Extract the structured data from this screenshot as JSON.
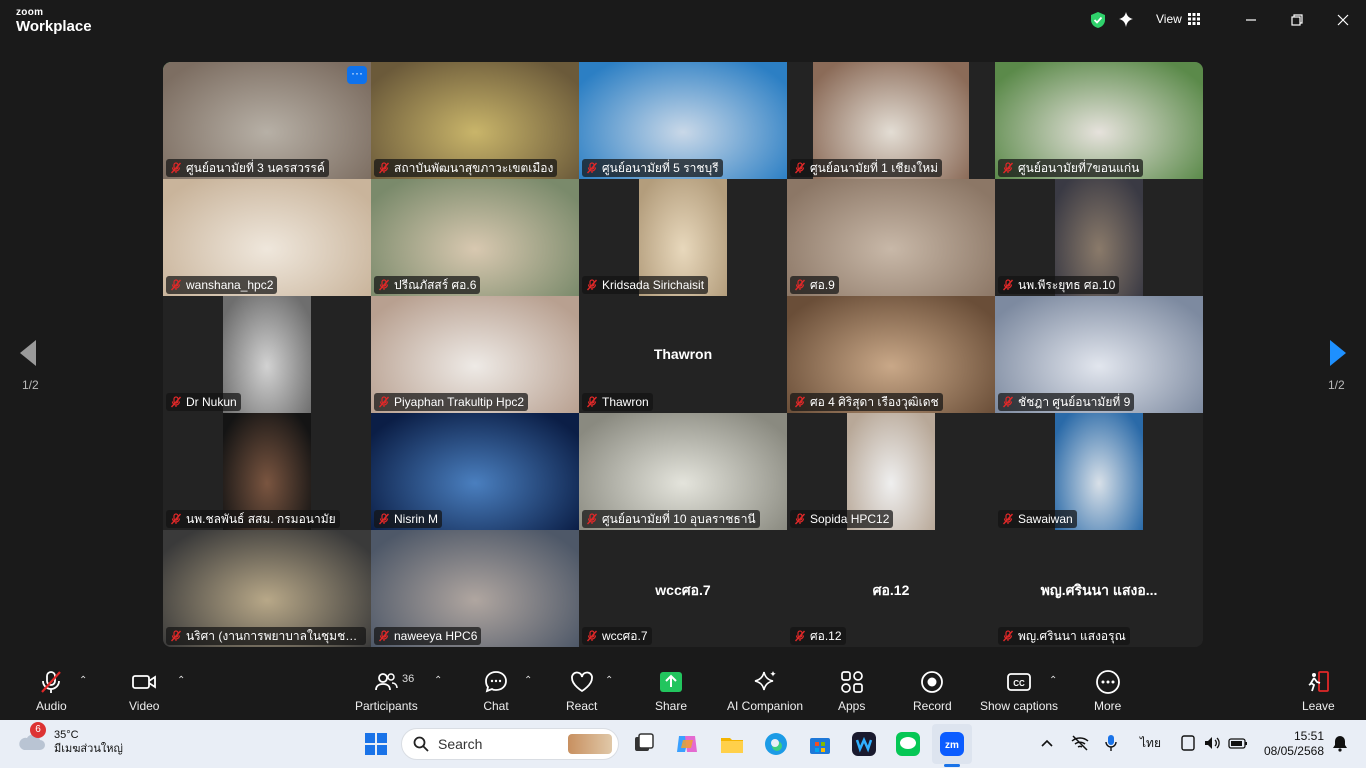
{
  "app": {
    "brand_top": "zoom",
    "brand_bottom": "Workplace",
    "view_label": "View"
  },
  "colors": {
    "active_speaker": "#2fd16b",
    "muted_icon": "#e02828",
    "share_green": "#22c55e",
    "leave_red": "#e02828"
  },
  "pager": {
    "left": "1/2",
    "right": "1/2"
  },
  "tiles": [
    {
      "name": "ศูนย์อนามัยที่ 3 นครสวรรค์",
      "video": true,
      "active": true,
      "more": "···",
      "v": {
        "l": 0,
        "w": 208,
        "c1": "#7d6e62",
        "c2": "#b7b0a6"
      }
    },
    {
      "name": "สถาบันพัฒนาสุขภาวะเขตเมือง",
      "video": true,
      "v": {
        "l": 0,
        "w": 208,
        "c1": "#6b5a3a",
        "c2": "#c9b56a"
      }
    },
    {
      "name": "ศูนย์อนามัยที่ 5 ราชบุรี",
      "video": true,
      "v": {
        "l": 0,
        "w": 208,
        "c1": "#2c7fc4",
        "c2": "#c9d8e8"
      }
    },
    {
      "name": "ศูนย์อนามัยที่ 1 เชียงใหม่",
      "video": true,
      "v": {
        "l": 26,
        "w": 156,
        "c1": "#8b6b58",
        "c2": "#e3ddd4"
      }
    },
    {
      "name": "ศูนย์อนามัยที่7ขอนแก่น",
      "video": true,
      "v": {
        "l": 0,
        "w": 208,
        "c1": "#5b8a4a",
        "c2": "#e6e2dc"
      }
    },
    {
      "name": "wanshana_hpc2",
      "video": true,
      "v": {
        "l": 0,
        "w": 208,
        "c1": "#c9b49b",
        "c2": "#efe7dc"
      }
    },
    {
      "name": "ปรีณภัสสร์ ศอ.6",
      "video": true,
      "v": {
        "l": 0,
        "w": 208,
        "c1": "#7a8a6b",
        "c2": "#d8c8b0"
      }
    },
    {
      "name": "Kridsada Sirichaisit",
      "video": true,
      "v": {
        "l": 60,
        "w": 88,
        "c1": "#b39d7c",
        "c2": "#e8d8bc"
      }
    },
    {
      "name": "ศอ.9",
      "video": true,
      "v": {
        "l": 0,
        "w": 208,
        "c1": "#8c7766",
        "c2": "#c8b8a8"
      }
    },
    {
      "name": "นพ.พีระยุทธ ศอ.10",
      "video": true,
      "v": {
        "l": 60,
        "w": 88,
        "c1": "#3a3a44",
        "c2": "#8a7a6a"
      }
    },
    {
      "name": "Dr Nukun",
      "video": true,
      "v": {
        "l": 60,
        "w": 88,
        "c1": "#6e6e6e",
        "c2": "#d2d2d2"
      }
    },
    {
      "name": "Piyaphan Trakultip Hpc2",
      "video": true,
      "v": {
        "l": 0,
        "w": 208,
        "c1": "#b8a090",
        "c2": "#eeeae6"
      }
    },
    {
      "name": "Thawron",
      "video": false,
      "center": "Thawron"
    },
    {
      "name": "ศอ 4 ศิริสุดา เรืองวุฒิเดช",
      "video": true,
      "v": {
        "l": 0,
        "w": 208,
        "c1": "#6a4e38",
        "c2": "#c9a888"
      }
    },
    {
      "name": "ชัชฎา ศูนย์อนามัยที่ 9",
      "video": true,
      "v": {
        "l": 0,
        "w": 208,
        "c1": "#7d8aa0",
        "c2": "#e2e6ee"
      }
    },
    {
      "name": "นพ.ชลพันธ์ สสม. กรมอนามัย",
      "video": true,
      "v": {
        "l": 60,
        "w": 88,
        "c1": "#141414",
        "c2": "#7a5540"
      }
    },
    {
      "name": "Nisrin M",
      "video": true,
      "v": {
        "l": 0,
        "w": 208,
        "c1": "#0b1e46",
        "c2": "#4a7fbf"
      }
    },
    {
      "name": "ศูนย์อนามัยที่ 10 อุบลราชธานี",
      "video": true,
      "v": {
        "l": 0,
        "w": 208,
        "c1": "#8a8a80",
        "c2": "#e4e4dc"
      }
    },
    {
      "name": "Sopida HPC12",
      "video": true,
      "v": {
        "l": 60,
        "w": 88,
        "c1": "#b8a898",
        "c2": "#efefef"
      }
    },
    {
      "name": "Sawaiwan",
      "video": true,
      "v": {
        "l": 60,
        "w": 88,
        "c1": "#2a6aa8",
        "c2": "#d8e0e8"
      }
    },
    {
      "name": "นริศา (งานการพยาบาลในชุมชน ศ...",
      "video": true,
      "v": {
        "l": 0,
        "w": 208,
        "c1": "#3a3a3a",
        "c2": "#b8a888"
      }
    },
    {
      "name": "naweeya HPC6",
      "video": true,
      "v": {
        "l": 0,
        "w": 208,
        "c1": "#4e5868",
        "c2": "#b0a6a0"
      }
    },
    {
      "name": "wccศอ.7",
      "video": false,
      "center": "wccศอ.7"
    },
    {
      "name": "ศอ.12",
      "video": false,
      "center": "ศอ.12"
    },
    {
      "name": "พญ.ศรินนา แสงอรุณ",
      "video": false,
      "center": "พญ.ศรินนา แสงอ..."
    }
  ],
  "toolbar": {
    "audio": "Audio",
    "video": "Video",
    "participants": "Participants",
    "participants_count": "36",
    "chat": "Chat",
    "react": "React",
    "share": "Share",
    "ai_companion": "AI Companion",
    "apps": "Apps",
    "record": "Record",
    "captions": "Show captions",
    "more": "More",
    "leave": "Leave"
  },
  "taskbar": {
    "weather_badge": "6",
    "temperature": "35°C",
    "weather_desc": "มีเมฆส่วนใหญ่",
    "search_placeholder": "Search",
    "language": "ไทย",
    "time": "15:51",
    "date": "08/05/2568"
  }
}
